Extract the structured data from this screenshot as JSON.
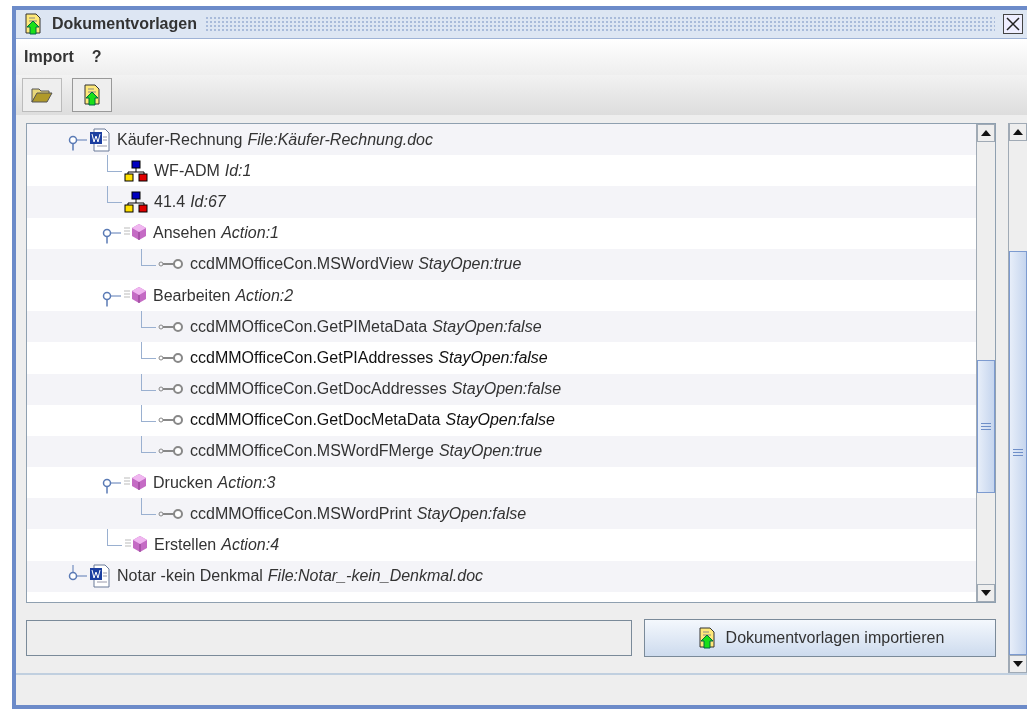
{
  "window": {
    "title": "Dokumentvorlagen"
  },
  "menu": [
    "Import",
    "?"
  ],
  "tree": [
    {
      "kind": "document",
      "name": "Käufer-Rechnung",
      "detail": "File:Käufer-Rechnung.doc",
      "expanded": true,
      "children": [
        {
          "kind": "workflow",
          "name": "WF-ADM",
          "detail": "Id:1"
        },
        {
          "kind": "workflow",
          "name": "41.4",
          "detail": "Id:67"
        },
        {
          "kind": "action",
          "name": "Ansehen",
          "detail": "Action:1",
          "expanded": true,
          "children": [
            {
              "kind": "method",
              "name": "ccdMMOfficeCon.MSWordView",
              "detail": "StayOpen:true",
              "dark": false
            }
          ]
        },
        {
          "kind": "action",
          "name": "Bearbeiten",
          "detail": "Action:2",
          "expanded": true,
          "children": [
            {
              "kind": "method",
              "name": "ccdMMOfficeCon.GetPIMetaData",
              "detail": "StayOpen:false",
              "dark": false
            },
            {
              "kind": "method",
              "name": "ccdMMOfficeCon.GetPIAddresses",
              "detail": "StayOpen:false",
              "dark": true
            },
            {
              "kind": "method",
              "name": "ccdMMOfficeCon.GetDocAddresses",
              "detail": "StayOpen:false",
              "dark": false
            },
            {
              "kind": "method",
              "name": "ccdMMOfficeCon.GetDocMetaData",
              "detail": "StayOpen:false",
              "dark": true
            },
            {
              "kind": "method",
              "name": "ccdMMOfficeCon.MSWordFMerge",
              "detail": "StayOpen:true",
              "dark": false
            }
          ]
        },
        {
          "kind": "action",
          "name": "Drucken",
          "detail": "Action:3",
          "expanded": true,
          "children": [
            {
              "kind": "method",
              "name": "ccdMMOfficeCon.MSWordPrint",
              "detail": "StayOpen:false",
              "dark": false
            }
          ]
        },
        {
          "kind": "action",
          "name": "Erstellen",
          "detail": "Action:4"
        }
      ]
    },
    {
      "kind": "document",
      "name": "Notar -kein Denkmal",
      "detail": "File:Notar_-kein_Denkmal.doc",
      "expanded": false
    }
  ],
  "import_button": "Dokumentvorlagen importieren"
}
